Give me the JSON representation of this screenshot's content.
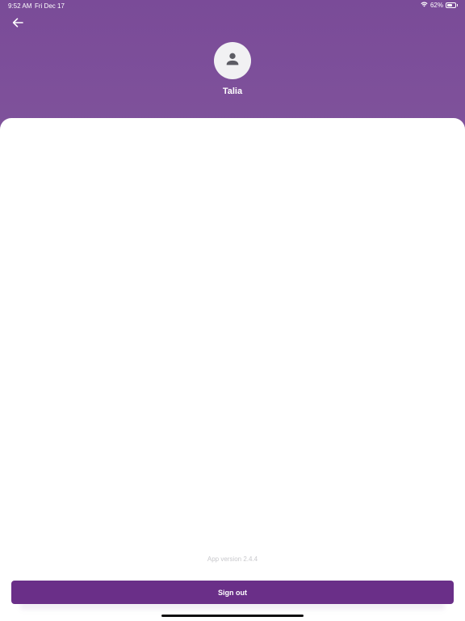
{
  "status_bar": {
    "time": "9:52 AM",
    "date": "Fri Dec 17",
    "battery_percent": "62%",
    "battery_level": 0.62,
    "wifi_icon": "wifi-icon",
    "battery_icon": "battery-icon"
  },
  "header": {
    "back_icon": "arrow-left-icon",
    "avatar_icon": "person-icon",
    "user_name": "Talia"
  },
  "footer": {
    "app_version": "App version 2.4.4",
    "sign_out_label": "Sign out"
  },
  "colors": {
    "header_purple": "#7e4f9a",
    "button_purple": "#6a2f88",
    "card_background": "#ffffff",
    "version_text": "#c8c8cc"
  }
}
